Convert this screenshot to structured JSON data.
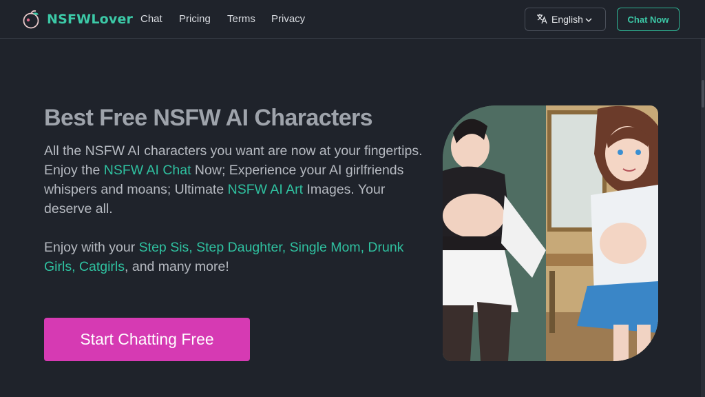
{
  "nav": {
    "brand": "NSFWLover",
    "links": [
      "Chat",
      "Pricing",
      "Terms",
      "Privacy"
    ],
    "language": "English",
    "cta": "Chat Now"
  },
  "hero": {
    "title": "Best Free NSFW AI Characters",
    "p1": {
      "t1": "All the NSFW AI characters you want are now at your fingertips. Enjoy the ",
      "link1": "NSFW AI Chat",
      "t2": " Now; Experience your AI girlfriends whispers and moans; Ultimate ",
      "link2": "NSFW AI Art",
      "t3": " Images. Your deserve all."
    },
    "p2": {
      "t1": "Enjoy with your ",
      "links": "Step Sis, Step Daughter, Single Mom, Drunk Girls, Catgirls",
      "t2": ", and many more!"
    },
    "button": "Start Chatting Free"
  },
  "colors": {
    "background": "#1f232b",
    "accent": "#2fc1a0",
    "cta": "#d63ab3"
  }
}
